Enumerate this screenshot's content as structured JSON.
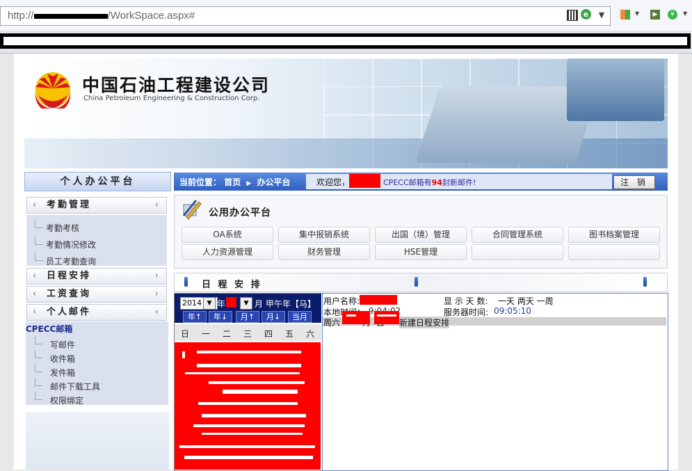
{
  "browser": {
    "url_prefix": "http://",
    "url_suffix": "/WorkSpace.aspx#"
  },
  "company": {
    "name_cn": "中国石油工程建设公司",
    "name_en": "China Petroleum Engineering & Construction Corp."
  },
  "sidebar": {
    "title": "个人办公平台",
    "sections": [
      {
        "label": "考勤管理",
        "items": [
          "考勤考核",
          "考勤情况修改",
          "员工考勤查询"
        ]
      },
      {
        "label": "日程安排"
      },
      {
        "label": "工资查询"
      },
      {
        "label": "个人邮件"
      }
    ],
    "mail_title": "CPECC邮箱",
    "mail_items": [
      "写邮件",
      "收件箱",
      "发件箱",
      "邮件下载工具",
      "权限绑定"
    ]
  },
  "header": {
    "location_label": "当前位置：",
    "crumb_home": "首页",
    "crumb_current": "办公平台",
    "welcome": "欢迎您，",
    "mail_prefix": "CPECC邮箱有",
    "mail_count": "94",
    "mail_suffix": "封新邮件!",
    "logout": "注 销"
  },
  "office": {
    "title": "公用办公平台",
    "buttons_row1": [
      "OA系统",
      "集中报销系统",
      "出国（境）管理",
      "合同管理系统",
      "图书档案管理"
    ],
    "buttons_row2": [
      "人力资源管理",
      "财务管理",
      "HSE管理",
      "",
      ""
    ]
  },
  "schedule": {
    "title": "日 程 安 排",
    "calendar": {
      "year": "2014",
      "year_label": "年",
      "month_label": "月",
      "lunar": "甲午年【马】",
      "nav_buttons": [
        "年↑",
        "年↓",
        "月↑",
        "月↓",
        "当月"
      ],
      "weekdays": [
        "日",
        "一",
        "二",
        "三",
        "四",
        "五",
        "六"
      ]
    },
    "user_label": "用户名称:",
    "local_time_label": "本地时间：",
    "local_time_partial": "9:04:02",
    "display_days_label": "显 示 天 数:",
    "display_days_options": "一天 两天 一周",
    "server_time_label": "服务器时间:",
    "server_time": "09:05:10",
    "row_day": "周六",
    "row_mid": "一月",
    "row_date": "日",
    "new_schedule": "新建日程安排"
  }
}
